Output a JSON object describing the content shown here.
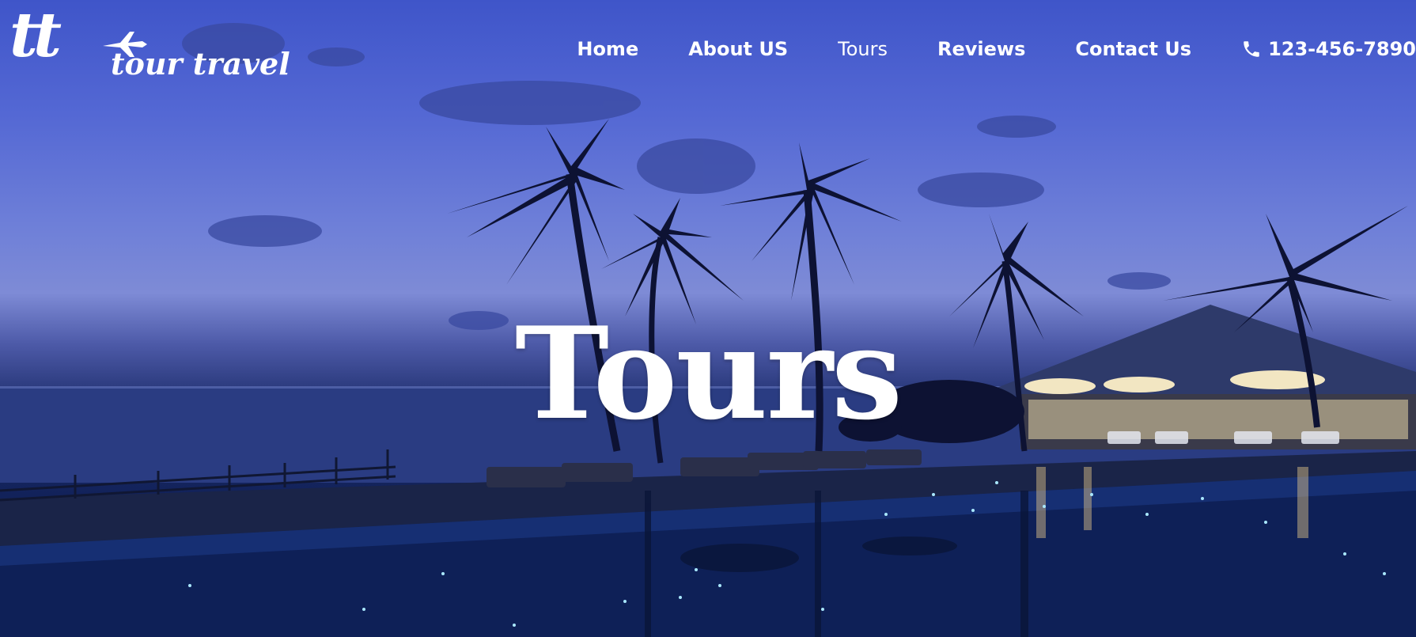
{
  "logo": {
    "monogram": "tt",
    "brand_text": "tour travel"
  },
  "nav": {
    "items": [
      {
        "label": "Home",
        "active": false
      },
      {
        "label": "About US",
        "active": false
      },
      {
        "label": "Tours",
        "active": true
      },
      {
        "label": "Reviews",
        "active": false
      },
      {
        "label": "Contact Us",
        "active": false
      }
    ],
    "phone": {
      "icon": "phone-icon",
      "number": "123-456-7890"
    }
  },
  "hero": {
    "title": "Tours",
    "background": "night-resort-infinity-pool-with-palm-trees"
  },
  "colors": {
    "sky_top": "#3f55c9",
    "sky_mid": "#7e8bd6",
    "water": "#12225a",
    "text": "#ffffff"
  }
}
